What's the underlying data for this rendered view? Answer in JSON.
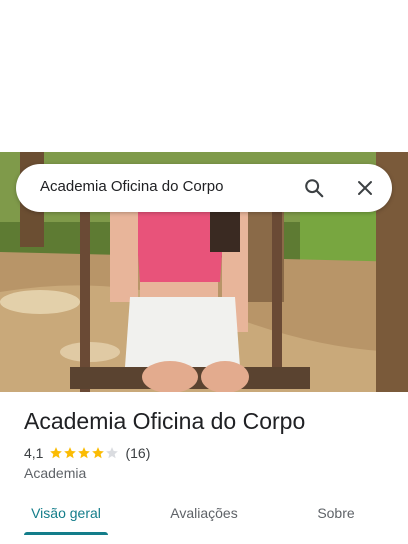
{
  "search": {
    "query": "Academia Oficina do Corpo"
  },
  "place": {
    "name": "Academia Oficina do Corpo",
    "rating": "4,1",
    "rating_value": 4.1,
    "review_count": "(16)",
    "category": "Academia"
  },
  "tabs": [
    {
      "label": "Visão geral",
      "active": true
    },
    {
      "label": "Avaliações",
      "active": false
    },
    {
      "label": "Sobre",
      "active": false
    }
  ],
  "colors": {
    "star": "#fbbc04",
    "star_empty": "#dadce0",
    "active_tab": "#137d8a"
  },
  "icons": {
    "search": "search-icon",
    "close": "close-icon"
  }
}
